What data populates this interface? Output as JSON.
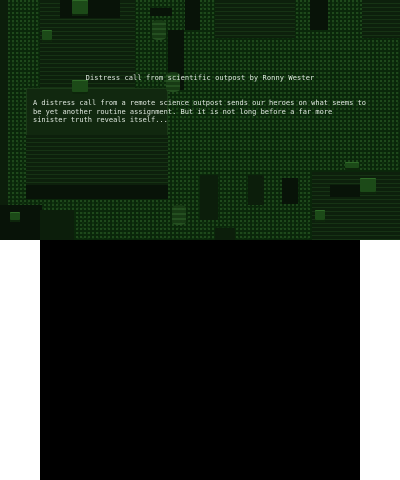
{
  "screen": {
    "top_background_color": "#0a260a",
    "bottom_background_color": "#000000",
    "text_color": "#dfe8df"
  },
  "intro": {
    "title": "Distress call from scientific outpost by Ronny Wester",
    "description": "A distress call from a remote science outpost sends our heroes on what seems to be yet another routine assignment. But it is not long before a far more sinister truth reveals itself..."
  }
}
